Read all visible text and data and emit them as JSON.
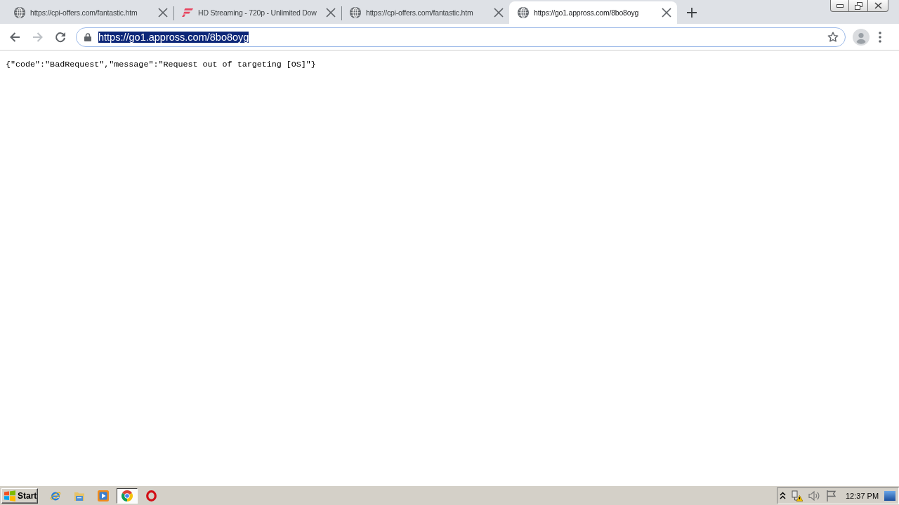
{
  "tabs": [
    {
      "kind": "globe",
      "title": "https://cpi-offers.com/fantastic.htm",
      "selected": false
    },
    {
      "kind": "streaming",
      "title": "HD Streaming - 720p - Unlimited Dow",
      "selected": false
    },
    {
      "kind": "globe",
      "title": "https://cpi-offers.com/fantastic.htm",
      "selected": false
    },
    {
      "kind": "globe",
      "title": "https://go1.appross.com/8bo8oyg",
      "selected": true
    }
  ],
  "toolbar": {
    "back_disabled": false,
    "forward_disabled": true
  },
  "address_bar": {
    "url": "https://go1.appross.com/8bo8oyg",
    "text_selected": true
  },
  "page": {
    "text": "{\"code\":\"BadRequest\",\"message\":\"Request out of targeting [OS]\"}"
  },
  "taskbar": {
    "start": "Start",
    "items": [
      {
        "kind": "ie",
        "selected": false
      },
      {
        "kind": "explorer",
        "selected": false
      },
      {
        "kind": "media",
        "selected": false
      },
      {
        "kind": "chrome",
        "selected": true
      },
      {
        "kind": "opera",
        "selected": false
      }
    ],
    "clock": "12:37 PM"
  }
}
